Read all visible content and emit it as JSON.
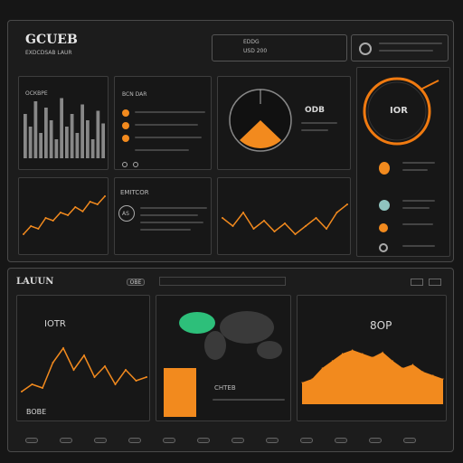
{
  "header": {
    "title": "GCUEB",
    "subtitle": "EXDCDSAB LAUR",
    "search": {
      "line1": "EDDG",
      "line2": "USD 200"
    }
  },
  "panel_bars": {
    "label": "ОСКВРЕ"
  },
  "panel_list": {
    "label": "BCN DAR"
  },
  "panel_gauge": {
    "label": "ODB"
  },
  "panel_ring": {
    "value": "IOR",
    "items": [
      "",
      "",
      ""
    ]
  },
  "panel_line1": {
    "label": ""
  },
  "panel_mid": {
    "label": "EMITCOR",
    "badge": "AS"
  },
  "section2": {
    "title": "LAUUN",
    "tab": "OBE"
  },
  "panel_bottom_left": {
    "value": "IOTR",
    "footer": "BOBE"
  },
  "panel_map": {
    "label": "CHTEB"
  },
  "panel_area": {
    "value": "8OP"
  },
  "colors": {
    "accent": "#f28a1e",
    "map_highlight": "#2dbf7a",
    "ring": "#f07a10"
  },
  "icons": [
    "toggle-icon",
    "settings-icon",
    "coin-icon",
    "globe-icon"
  ],
  "chart_data": [
    {
      "type": "bar",
      "values": [
        0.7,
        0.5,
        0.9,
        0.4,
        0.8,
        0.6,
        0.3,
        0.95,
        0.5,
        0.7,
        0.4,
        0.85,
        0.6,
        0.3,
        0.75,
        0.55
      ]
    },
    {
      "type": "line",
      "values": [
        0.2,
        0.35,
        0.3,
        0.5,
        0.45,
        0.6,
        0.55,
        0.7,
        0.62,
        0.8,
        0.75,
        0.9
      ]
    },
    {
      "type": "line",
      "values": [
        0.5,
        0.35,
        0.6,
        0.3,
        0.45,
        0.25,
        0.4,
        0.2,
        0.35,
        0.5,
        0.3,
        0.6,
        0.75
      ]
    },
    {
      "type": "line",
      "values": [
        0.2,
        0.3,
        0.25,
        0.6,
        0.8,
        0.5,
        0.7,
        0.4,
        0.55,
        0.3,
        0.5,
        0.35,
        0.4
      ]
    },
    {
      "type": "area",
      "values": [
        0.3,
        0.35,
        0.5,
        0.6,
        0.7,
        0.75,
        0.7,
        0.65,
        0.72,
        0.6,
        0.5,
        0.55,
        0.45,
        0.4,
        0.35
      ]
    }
  ]
}
